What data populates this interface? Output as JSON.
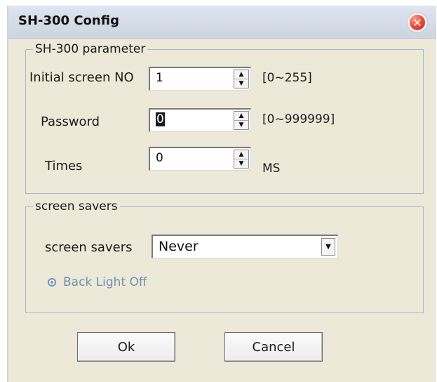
{
  "window": {
    "title": "SH-300 Config",
    "close_icon": "close-icon"
  },
  "parameter_group": {
    "legend": "SH-300 parameter",
    "initial_screen": {
      "label": "Initial screen NO",
      "value": "1",
      "range": "[0~255]"
    },
    "password": {
      "label": "Password",
      "value": "0",
      "range": "[0~999999]"
    },
    "times": {
      "label": "Times",
      "value": "0",
      "unit": "MS"
    }
  },
  "screensaver_group": {
    "legend": "screen savers",
    "select": {
      "label": "screen savers",
      "value": "Never"
    },
    "radio": {
      "label": "Back Light Off",
      "checked": true
    }
  },
  "buttons": {
    "ok": "Ok",
    "cancel": "Cancel"
  },
  "colors": {
    "dialog_bg": "#ece9d8",
    "group_border": "#a6b8cc",
    "disabled_text": "#6f8fb4",
    "close_red": "#e64a36"
  }
}
